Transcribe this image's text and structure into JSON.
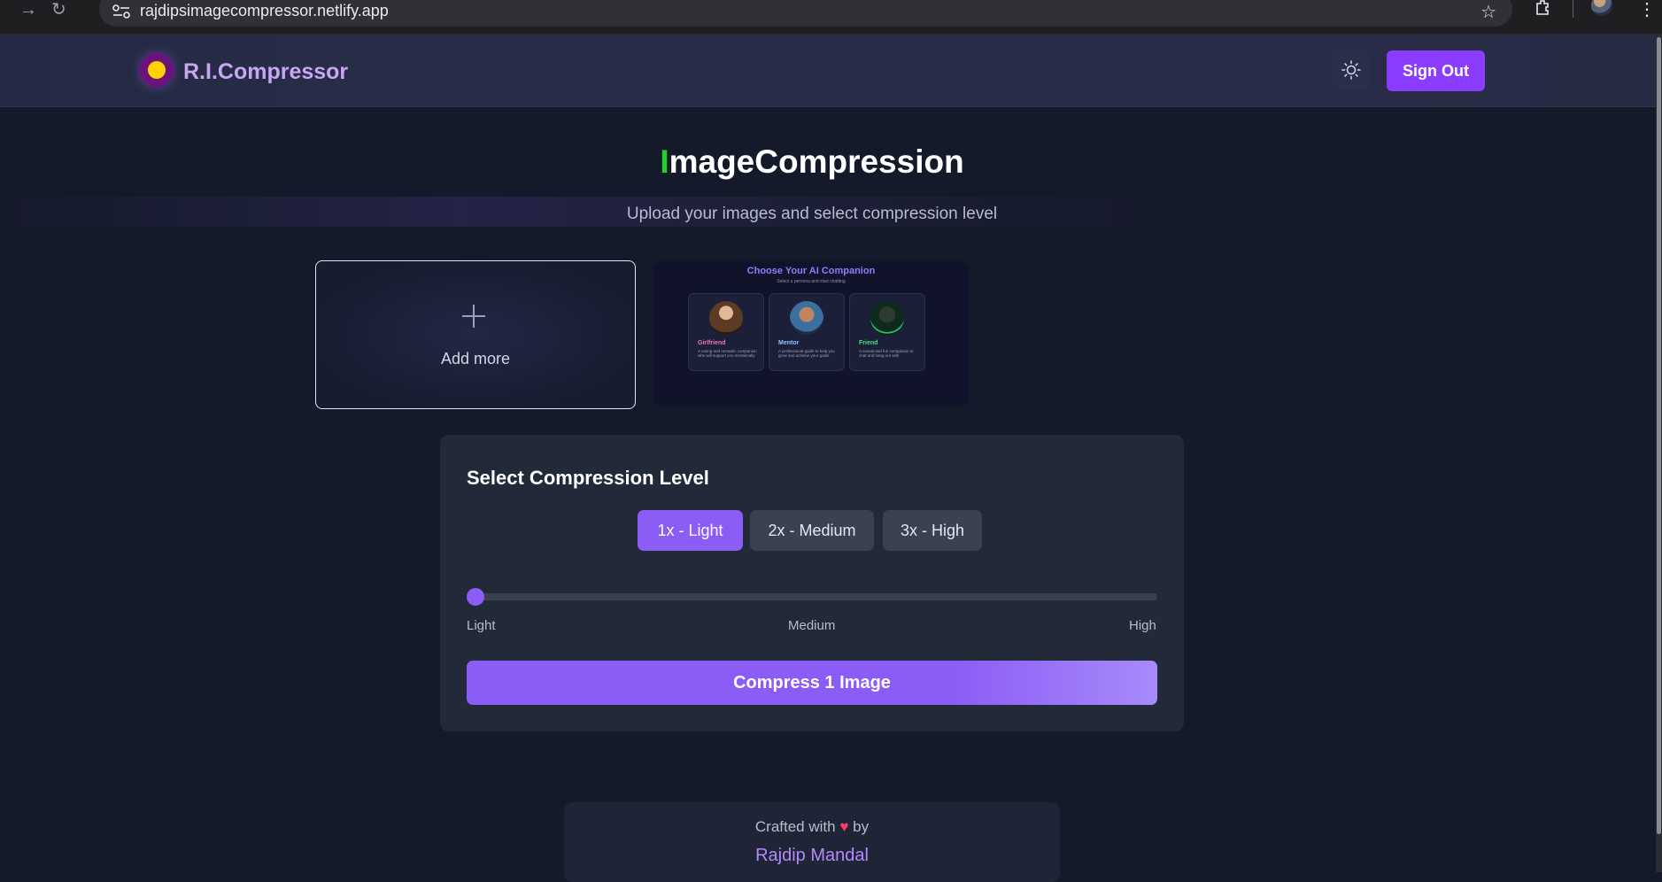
{
  "browser": {
    "url": "rajdipsimagecompressor.netlify.app"
  },
  "header": {
    "brand": "R.I.Compressor",
    "sign_out_label": "Sign Out",
    "logo_icon": "logo-icon",
    "theme_icon": "sun-icon"
  },
  "hero": {
    "title_first_letter": "I",
    "title_rest": "mageCompression",
    "subtitle": "Upload your images and select compression level"
  },
  "uploads": {
    "add_more_label": "Add more",
    "thumbnail": {
      "title": "Choose Your AI Companion",
      "subtitle": "Select a persona and start chatting",
      "cards": [
        {
          "name": "Girlfriend",
          "desc": "A caring and romantic companion who will support you emotionally"
        },
        {
          "name": "Mentor",
          "desc": "A professional guide to help you grow and achieve your goals"
        },
        {
          "name": "Friend",
          "desc": "A casual and fun companion to chat and hang out with"
        }
      ]
    }
  },
  "compression": {
    "title": "Select Compression Level",
    "levels": [
      "1x - Light",
      "2x - Medium",
      "3x - High"
    ],
    "selected_level": "1x - Light",
    "slider_labels": [
      "Light",
      "Medium",
      "High"
    ],
    "slider_value_fraction": 0,
    "compress_label": "Compress 1 Image"
  },
  "footer": {
    "crafted_prefix": "Crafted with",
    "heart": "♥",
    "crafted_suffix": "by",
    "author": "Rajdip Mandal"
  },
  "colors": {
    "accent": "#8b5cf6",
    "sign_out": "#8b3dff",
    "brand": "#c8a6f2",
    "title_highlight": "#22d32a",
    "background": "#151a2b"
  }
}
